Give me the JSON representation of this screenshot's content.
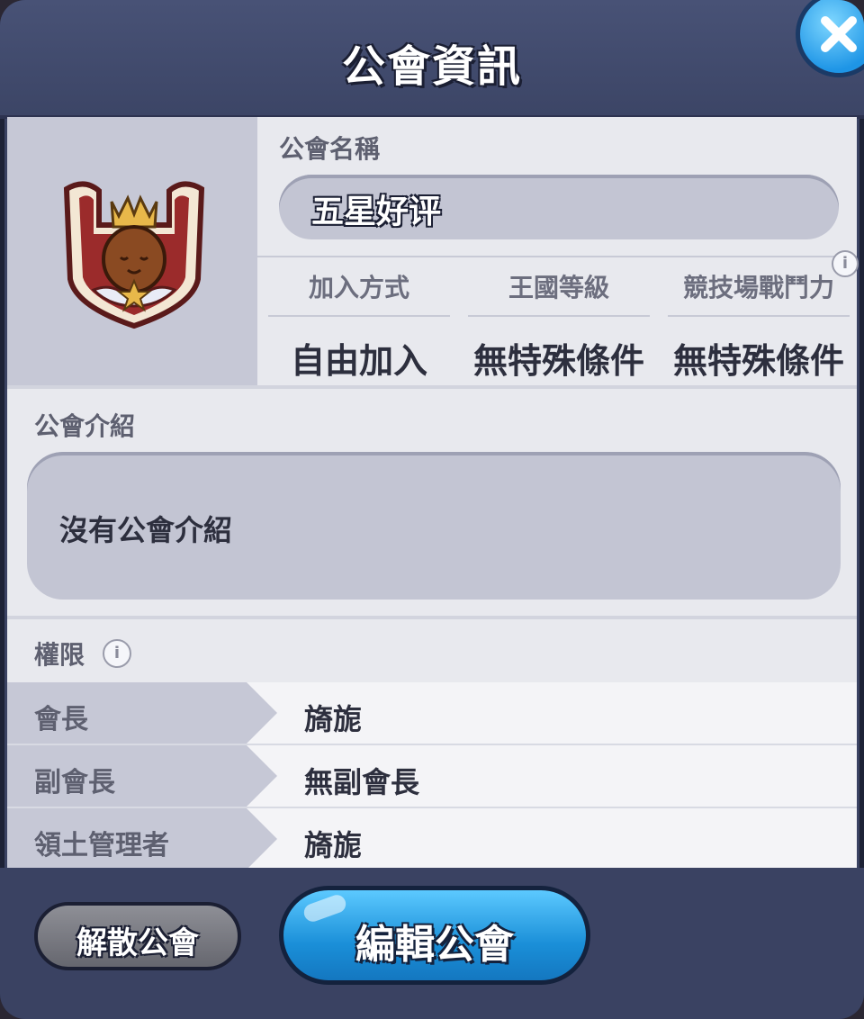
{
  "header": {
    "title": "公會資訊"
  },
  "guild": {
    "name_label": "公會名稱",
    "name": "五星好评",
    "stats": [
      {
        "label": "加入方式",
        "value": "自由加入"
      },
      {
        "label": "王國等級",
        "value": "無特殊條件"
      },
      {
        "label": "競技場戰鬥力",
        "value": "無特殊條件"
      }
    ]
  },
  "intro": {
    "label": "公會介紹",
    "text": "沒有公會介紹"
  },
  "permissions": {
    "label": "權限",
    "rows": [
      {
        "role": "會長",
        "holder": "旖旎"
      },
      {
        "role": "副會長",
        "holder": "無副會長"
      },
      {
        "role": "領土管理者",
        "holder": "旖旎"
      }
    ]
  },
  "footer": {
    "disband_label": "解散公會",
    "edit_label": "編輯公會"
  },
  "icons": {
    "close": "close-icon",
    "emblem": "guild-emblem-icon",
    "info": "info-icon"
  },
  "colors": {
    "panel": "#3a4262",
    "edit_button": "#1a8fd8",
    "disband_button": "#7a7b83",
    "emblem_red": "#9b2b2b",
    "emblem_gold": "#e8b84a"
  }
}
